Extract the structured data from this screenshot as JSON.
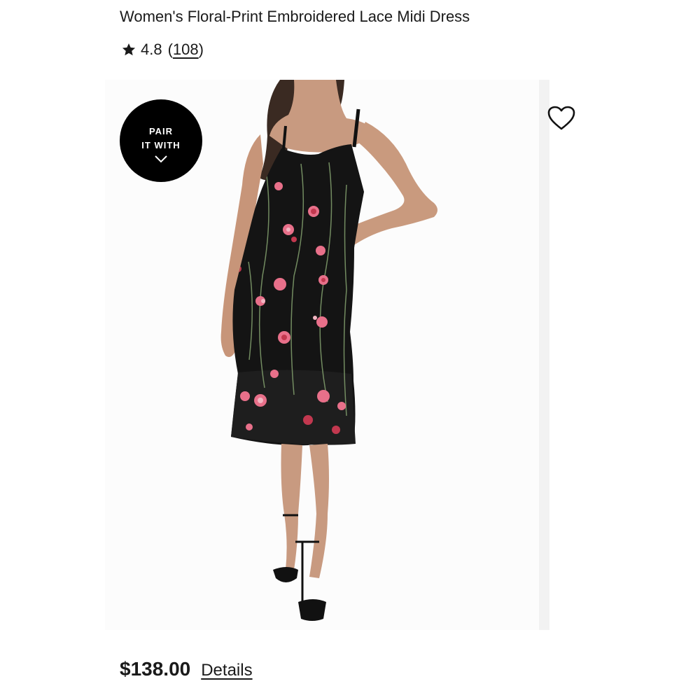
{
  "product": {
    "title": "Women's Floral-Print Embroidered Lace Midi Dress",
    "rating": "4.8",
    "review_count_open": "(",
    "review_count": "108",
    "review_count_close": ")",
    "price": "$138.00",
    "details_label": "Details"
  },
  "pair_badge": {
    "line1": "PAIR",
    "line2": "IT WITH",
    "icon": "chevron-down-icon"
  },
  "icons": {
    "rating": "star-icon",
    "wishlist": "heart-outline-icon"
  },
  "colors": {
    "text": "#1a1a1a",
    "badge_bg": "#000000",
    "badge_text": "#ffffff",
    "dress": "#141414",
    "embroidery_pink": "#e8708a",
    "embroidery_red": "#c2384f",
    "embroidery_green": "#7e9a6a"
  }
}
